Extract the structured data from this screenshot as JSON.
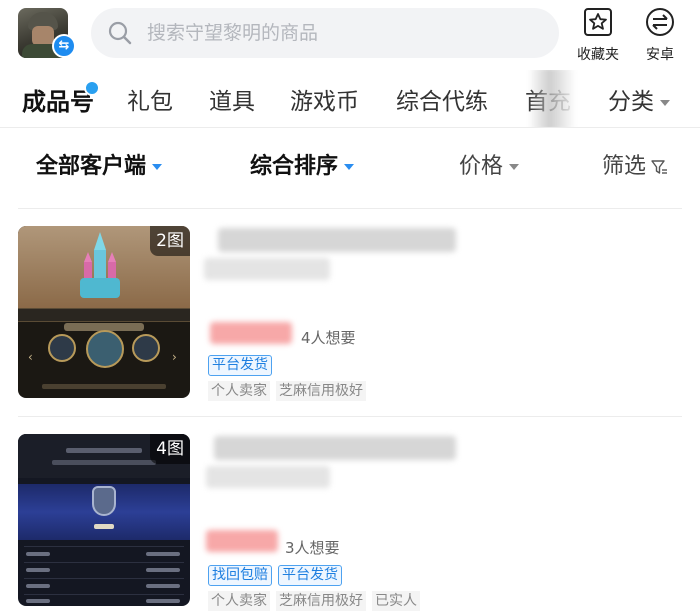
{
  "header": {
    "search_placeholder": "搜索守望黎明的商品",
    "favorites_label": "收藏夹",
    "platform_label": "安卓"
  },
  "tabs": [
    {
      "label": "成品号",
      "active": true
    },
    {
      "label": "礼包"
    },
    {
      "label": "道具"
    },
    {
      "label": "游戏币"
    },
    {
      "label": "综合代练"
    },
    {
      "label": "首充"
    }
  ],
  "tab_more_label": "分类",
  "filters": {
    "client": "全部客户端",
    "sort": "综合排序",
    "price": "价格",
    "filter": "筛选"
  },
  "listings": [
    {
      "image_count": "2图",
      "wants": "4人想要",
      "tags": [
        "平台发货"
      ],
      "attributes": [
        "个人卖家",
        "芝麻信用极好"
      ]
    },
    {
      "image_count": "4图",
      "wants": "3人想要",
      "tags": [
        "找回包赔",
        "平台发货"
      ],
      "attributes": [
        "个人卖家",
        "芝麻信用极好",
        "已实人"
      ]
    }
  ],
  "colors": {
    "accent_blue": "#1e8cf0",
    "tag_blue": "#1e7fe0",
    "price_red_blur": "#f7a8a8"
  }
}
